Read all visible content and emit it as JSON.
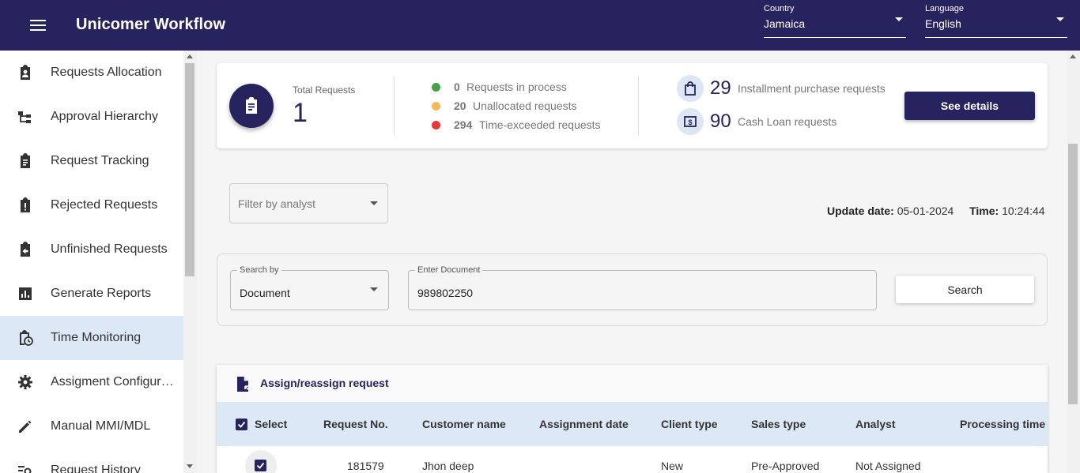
{
  "header": {
    "title": "Unicomer Workflow",
    "country": {
      "label": "Country",
      "value": "Jamaica"
    },
    "language": {
      "label": "Language",
      "value": "English"
    }
  },
  "sidebar": {
    "items": [
      {
        "label": "Requests Allocation",
        "icon": "clipboard-account-icon"
      },
      {
        "label": "Approval Hierarchy",
        "icon": "hierarchy-icon"
      },
      {
        "label": "Request Tracking",
        "icon": "clipboard-text-icon"
      },
      {
        "label": "Rejected Requests",
        "icon": "clipboard-alert-icon"
      },
      {
        "label": "Unfinished Requests",
        "icon": "clipboard-arrow-left-icon"
      },
      {
        "label": "Generate Reports",
        "icon": "bar-chart-icon"
      },
      {
        "label": "Time Monitoring",
        "icon": "clipboard-clock-icon",
        "active": true
      },
      {
        "label": "Assigment Configuration",
        "icon": "gear-icon"
      },
      {
        "label": "Manual MMI/MDL",
        "icon": "pencil-icon"
      },
      {
        "label": "Request History",
        "icon": "history-search-icon"
      }
    ]
  },
  "summary": {
    "total_label": "Total Requests",
    "total_value": "1",
    "stats": [
      {
        "count": "0",
        "label": "Requests in process",
        "color": "#43a047"
      },
      {
        "count": "20",
        "label": "Unallocated requests",
        "color": "#f6b957"
      },
      {
        "count": "294",
        "label": "Time-exceeded requests",
        "color": "#e53935"
      }
    ],
    "types": [
      {
        "count": "29",
        "label": "Installment purchase requests",
        "icon": "shopping-bag-icon"
      },
      {
        "count": "90",
        "label": "Cash Loan requests",
        "icon": "cash-icon"
      }
    ],
    "details_button": "See details"
  },
  "filter": {
    "placeholder": "Filter by analyst"
  },
  "update": {
    "date_label": "Update date:",
    "date_value": "05-01-2024",
    "time_label": "Time:",
    "time_value": "10:24:44"
  },
  "search": {
    "by_label": "Search by",
    "by_value": "Document",
    "doc_label": "Enter Document",
    "doc_value": "989802250",
    "button": "Search"
  },
  "table": {
    "title": "Assign/reassign request",
    "columns": [
      "Select",
      "Request No.",
      "Customer name",
      "Assignment date",
      "Client type",
      "Sales type",
      "Analyst",
      "Processing time"
    ],
    "rows": [
      {
        "request_no": "181579",
        "customer": "Jhon deep",
        "assignment_date": "",
        "client_type": "New",
        "sales_type": "Pre-Approved",
        "analyst": "Not Assigned",
        "processing_time": ""
      }
    ]
  },
  "colors": {
    "primary": "#27235e",
    "active_bg": "#dde8f7"
  }
}
